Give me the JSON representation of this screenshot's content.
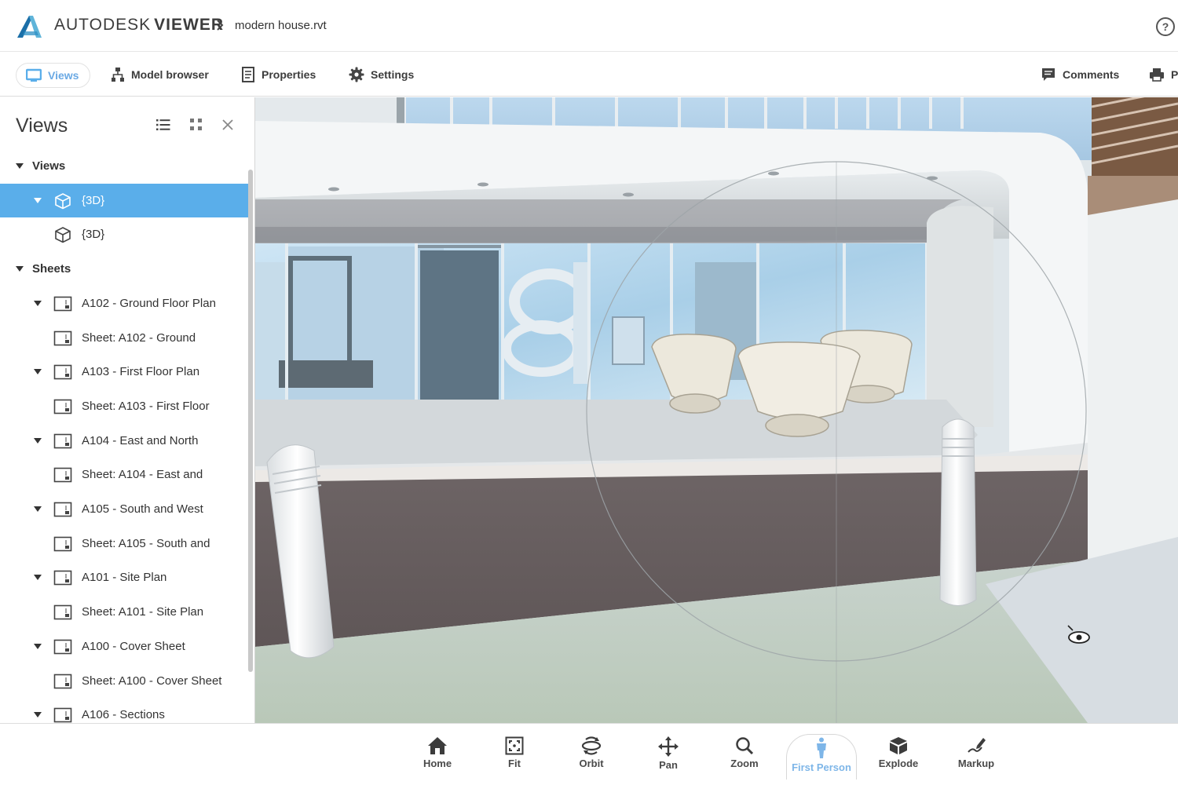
{
  "header": {
    "brand_primary": "AUTODESK",
    "brand_secondary": "VIEWER",
    "file_name": "modern house.rvt",
    "help_label": "?"
  },
  "toolbar": {
    "views": "Views",
    "model_browser": "Model browser",
    "properties": "Properties",
    "settings": "Settings",
    "comments": "Comments",
    "print": "P"
  },
  "panel": {
    "title": "Views",
    "items": [
      {
        "label": "Views",
        "level": 0,
        "expanded": true,
        "type": "section"
      },
      {
        "label": "{3D}",
        "level": 1,
        "expanded": true,
        "type": "cube",
        "selected": true
      },
      {
        "label": "{3D}",
        "level": 2,
        "type": "cube"
      },
      {
        "label": "Sheets",
        "level": 0,
        "expanded": true,
        "type": "section"
      },
      {
        "label": "A102 - Ground Floor Plan",
        "level": 1,
        "expanded": true,
        "type": "sheet"
      },
      {
        "label": "Sheet: A102 - Ground",
        "level": 2,
        "type": "sheet"
      },
      {
        "label": "A103 - First Floor Plan",
        "level": 1,
        "expanded": true,
        "type": "sheet"
      },
      {
        "label": "Sheet: A103 - First Floor",
        "level": 2,
        "type": "sheet"
      },
      {
        "label": "A104 - East and North",
        "level": 1,
        "expanded": true,
        "type": "sheet"
      },
      {
        "label": "Sheet: A104 - East and",
        "level": 2,
        "type": "sheet"
      },
      {
        "label": "A105 - South and West",
        "level": 1,
        "expanded": true,
        "type": "sheet"
      },
      {
        "label": "Sheet: A105 - South and",
        "level": 2,
        "type": "sheet"
      },
      {
        "label": "A101 - Site Plan",
        "level": 1,
        "expanded": true,
        "type": "sheet"
      },
      {
        "label": "Sheet: A101 - Site Plan",
        "level": 2,
        "type": "sheet"
      },
      {
        "label": "A100 - Cover Sheet",
        "level": 1,
        "expanded": true,
        "type": "sheet"
      },
      {
        "label": "Sheet: A100 - Cover Sheet",
        "level": 2,
        "type": "sheet"
      },
      {
        "label": "A106 - Sections",
        "level": 1,
        "expanded": true,
        "type": "sheet"
      }
    ]
  },
  "bottom_nav": [
    {
      "label": "Home",
      "icon": "home-icon"
    },
    {
      "label": "Fit",
      "icon": "fit-icon"
    },
    {
      "label": "Orbit",
      "icon": "orbit-icon"
    },
    {
      "label": "Pan",
      "icon": "pan-icon"
    },
    {
      "label": "Zoom",
      "icon": "zoom-icon"
    },
    {
      "label": "First Person",
      "icon": "first-person-icon",
      "active": true
    },
    {
      "label": "Explode",
      "icon": "explode-icon"
    },
    {
      "label": "Markup",
      "icon": "markup-icon"
    }
  ],
  "colors": {
    "accent": "#5aaeea",
    "active_tool": "#7eb6e8",
    "text": "#3c3c3c"
  }
}
